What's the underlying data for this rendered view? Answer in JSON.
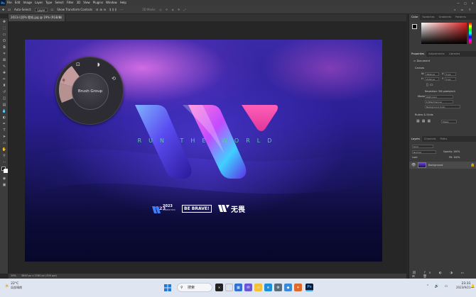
{
  "app": {
    "logo_text": "Ps"
  },
  "menu": [
    "File",
    "Edit",
    "Image",
    "Layer",
    "Type",
    "Select",
    "Filter",
    "3D",
    "View",
    "Plugins",
    "Window",
    "Help"
  ],
  "window_controls": [
    "—",
    "▢",
    "✕"
  ],
  "options_bar": {
    "auto_select": "Auto-Select:",
    "layer": "Layer",
    "transform": "Show Transform Controls",
    "mode3d": "3D Mode:"
  },
  "document": {
    "tab_title": "2023人民Pa 壁纸.jpg @ 19% (RGB/8)",
    "close": "×"
  },
  "canvas": {
    "brand_text": "RUN THE WORLD",
    "logo_year": "2023",
    "logo_sub": "CHINESE EXPO",
    "be_brave": "BE BRAVE!",
    "cn_brand": "无畏"
  },
  "radial_menu": {
    "label": "Brush Group"
  },
  "status": {
    "zoom": "19%",
    "size": "3840 px x 2160 px (300 ppi)"
  },
  "right_panel": {
    "color_tabs": [
      "Color",
      "Swatches",
      "Gradients",
      "Patterns"
    ],
    "prop_tabs": [
      "Properties",
      "Adjustments",
      "Libraries"
    ],
    "doc_label": "Document",
    "canvas_label": "Canvas",
    "w_label": "W",
    "w_value": "3840 px",
    "h_label": "H",
    "h_value": "2160 px",
    "x_label": "X",
    "x_value": "0 px",
    "y_label": "Y",
    "y_value": "0 px",
    "resolution": "Resolution: 300 pixels/inch",
    "mode_label": "Mode",
    "mode_value": "RGB Color",
    "bits_value": "8 Bits/Channel",
    "fill_value": "Background Color",
    "rulers_label": "Rulers & Grids",
    "px_unit": "Pixels",
    "layer_tabs": [
      "Layers",
      "Channels",
      "Paths"
    ],
    "layer_kind": "Kind",
    "blend": "Normal",
    "opacity": "Opacity: 100%",
    "lock": "Lock:",
    "fill": "Fill: 100%",
    "layer_name": "Background"
  },
  "taskbar": {
    "weather_temp": "22°C",
    "weather_desc": "局部晴朗",
    "search_placeholder": "搜索",
    "time": "23:31",
    "date": "2023/9/21"
  },
  "colors": {
    "accent": "#31a8ff",
    "brand_green": "#4ed68a",
    "canvas_top": "#3b2aa8",
    "canvas_bottom": "#07072a"
  }
}
